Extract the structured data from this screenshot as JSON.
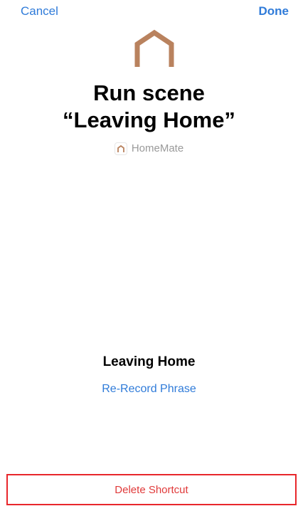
{
  "nav": {
    "cancel_label": "Cancel",
    "done_label": "Done"
  },
  "scene": {
    "icon": "house-icon",
    "icon_color": "#b9825e",
    "title_line1": "Run scene",
    "title_line2": "“Leaving Home”"
  },
  "app": {
    "icon": "house-icon",
    "name": "HomeMate"
  },
  "phrase": {
    "text": "Leaving Home",
    "rerecord_label": "Re-Record Phrase"
  },
  "actions": {
    "delete_label": "Delete Shortcut"
  },
  "colors": {
    "accent": "#2f7bd9",
    "destructive": "#e03a3a",
    "highlight_border": "#e8262b"
  }
}
